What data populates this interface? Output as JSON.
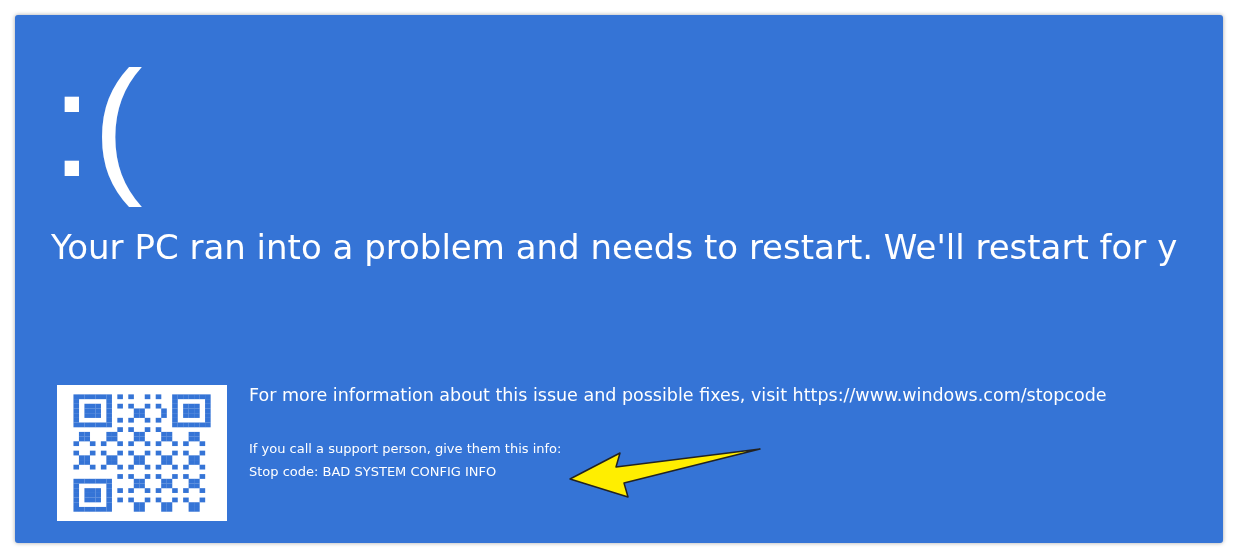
{
  "screen": {
    "face": ":(",
    "headline": "Your PC ran into a problem and needs to restart. We'll restart for y",
    "info": "For more information about this issue and possible fixes, visit https://www.windows.com/stopcode",
    "support": "If you call a support person, give them this info:",
    "stop_code": "Stop code: BAD SYSTEM CONFIG INFO"
  }
}
